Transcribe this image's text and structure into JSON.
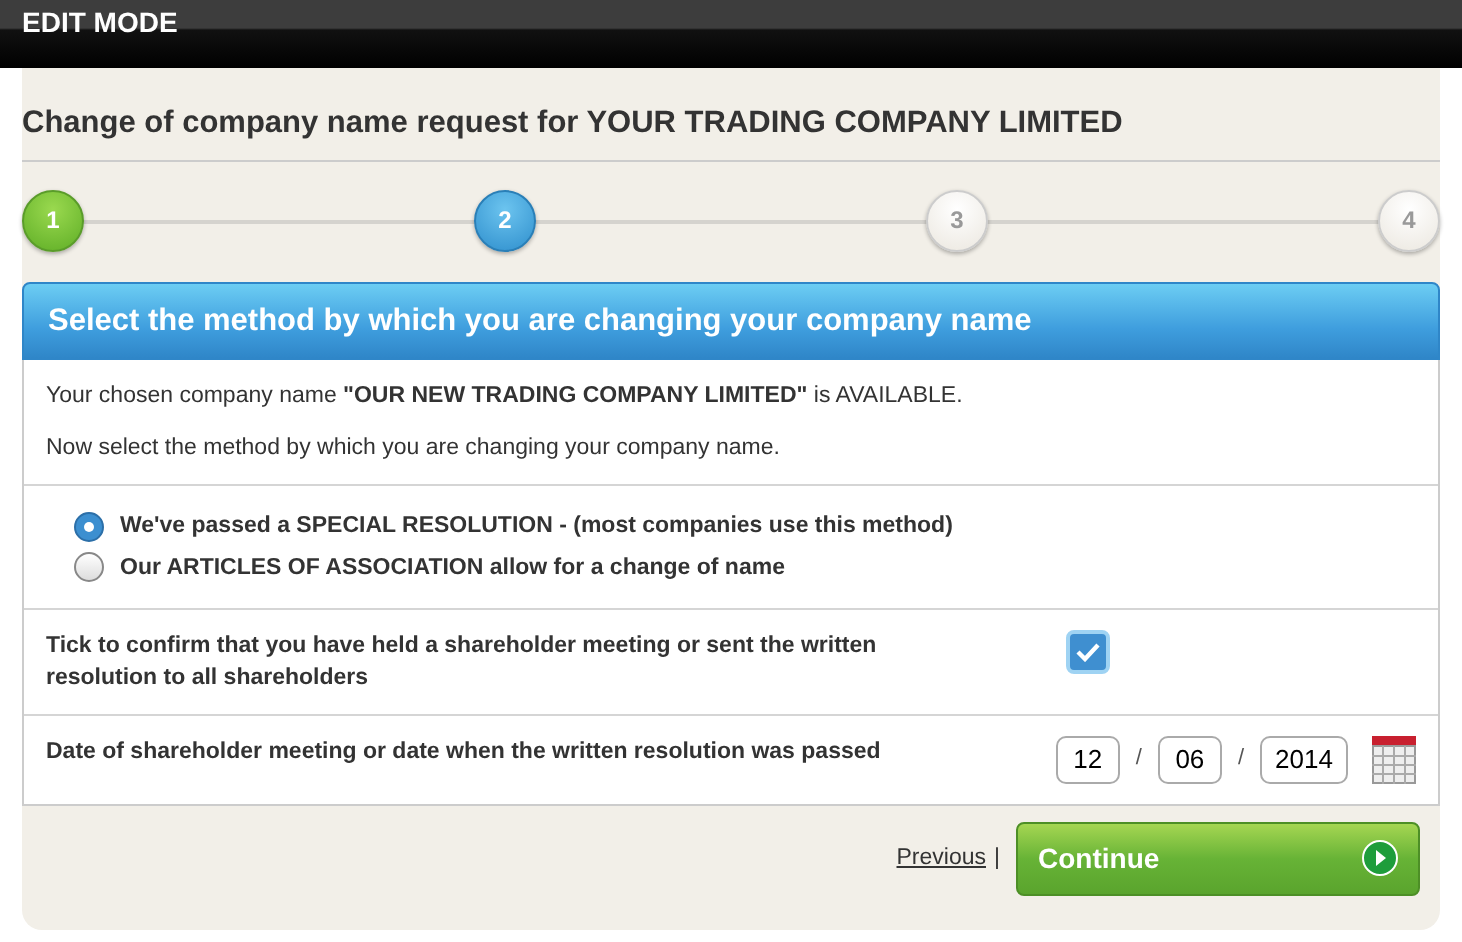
{
  "topbar": {
    "title": "EDIT MODE"
  },
  "page_title": "Change of company name request for YOUR TRADING COMPANY LIMITED",
  "steps": [
    {
      "label": "1",
      "completed": true,
      "selected": false
    },
    {
      "label": "2",
      "completed": false,
      "selected": true
    },
    {
      "label": "3",
      "completed": false,
      "selected": false
    },
    {
      "label": "4",
      "completed": false,
      "selected": false
    }
  ],
  "panel": {
    "heading": "Select the method by which you are changing your company name",
    "messages": [
      "Your chosen company name **\"OUR NEW TRADING COMPANY LIMITED\"** is AVAILABLE.",
      "Now select the method by which you are changing your company name."
    ],
    "options": [
      {
        "label": "We've passed a SPECIAL RESOLUTION - (most companies use this method)",
        "selected": true
      },
      {
        "label": "Our ARTICLES OF ASSOCIATION allow for a change of name",
        "selected": false
      }
    ],
    "confirm": {
      "label": "Tick to confirm that you have held a shareholder meeting or sent the written resolution to all shareholders",
      "checked": true
    },
    "date": {
      "label": "Date of shareholder meeting or date when the written resolution was passed",
      "day": "12",
      "month": "06",
      "year": "2014",
      "separators": [
        "/",
        "/"
      ]
    }
  },
  "footer": {
    "previous": "Previous",
    "divider": "|",
    "continue": "Continue"
  }
}
